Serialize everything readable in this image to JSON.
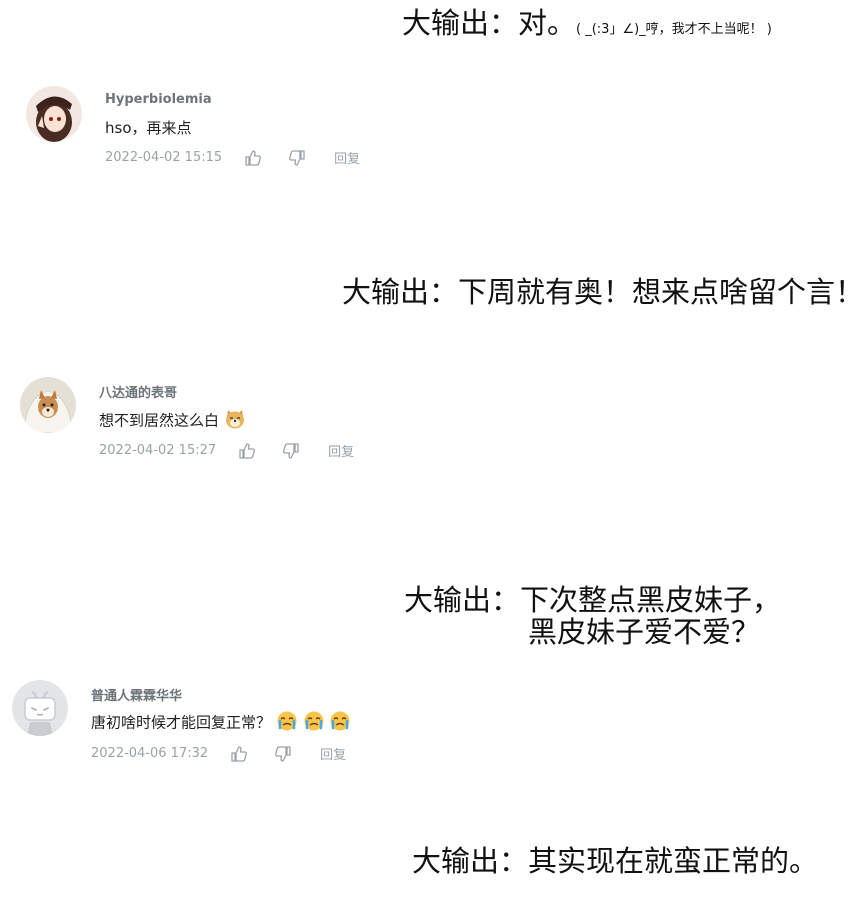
{
  "replies": [
    {
      "main": "大输出：对。",
      "tail": "( _(:3」∠)_哼，我才不上当呢！ )"
    },
    {
      "main": "大输出：下周就有奥！想来点啥留个言！"
    },
    {
      "line1": "大输出：下次整点黑皮妹子，",
      "line2": "黑皮妹子爱不爱？"
    },
    {
      "main": "大输出：其实现在就蛮正常的。"
    }
  ],
  "comments": [
    {
      "username": "Hyperbiolemia",
      "text": "hso，再来点",
      "time": "2022-04-02 15:15",
      "reply_label": "回复",
      "avatar": "anime-girl-avatar"
    },
    {
      "username": "八达通的表哥",
      "text": "想不到居然这么白",
      "time": "2022-04-02 15:27",
      "reply_label": "回复",
      "avatar": "shiba-dog-avatar",
      "emoji": "doge-emoji"
    },
    {
      "username": "普通人霖霖华华",
      "text": "唐初啥时候才能回复正常？",
      "time": "2022-04-06 17:32",
      "reply_label": "回复",
      "avatar": "bilibili-tv-avatar",
      "emoji": "crying-emoji"
    }
  ],
  "colors": {
    "username": "#6d757a",
    "meta": "#99a2aa",
    "text": "#222222"
  }
}
